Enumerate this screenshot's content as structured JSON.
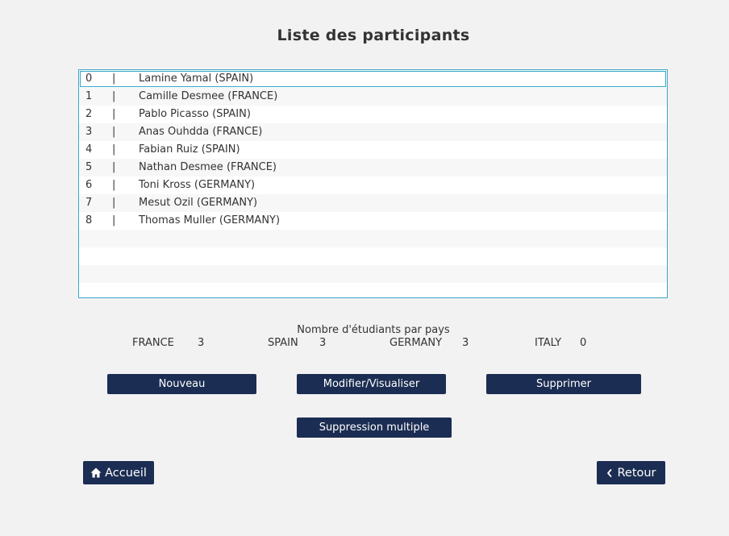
{
  "page": {
    "title": "Liste des participants"
  },
  "participants": {
    "separator": "|",
    "rows": [
      {
        "index": "0",
        "name": "Lamine Yamal (SPAIN)"
      },
      {
        "index": "1",
        "name": "Camille Desmee (FRANCE)"
      },
      {
        "index": "2",
        "name": "Pablo Picasso (SPAIN)"
      },
      {
        "index": "3",
        "name": "Anas Ouhdda (FRANCE)"
      },
      {
        "index": "4",
        "name": "Fabian Ruiz (SPAIN)"
      },
      {
        "index": "5",
        "name": "Nathan Desmee (FRANCE)"
      },
      {
        "index": "6",
        "name": "Toni Kross (GERMANY)"
      },
      {
        "index": "7",
        "name": "Mesut Ozil (GERMANY)"
      },
      {
        "index": "8",
        "name": "Thomas Muller (GERMANY)"
      }
    ],
    "selected_index": 0
  },
  "stats": {
    "title": "Nombre d'étudiants par pays",
    "countries": [
      {
        "name": "FRANCE",
        "count": "3"
      },
      {
        "name": "SPAIN",
        "count": "3"
      },
      {
        "name": "GERMANY",
        "count": "3"
      },
      {
        "name": "ITALY",
        "count": "0"
      }
    ]
  },
  "actions": {
    "new_label": "Nouveau",
    "edit_label": "Modifier/Visualiser",
    "delete_label": "Supprimer",
    "multi_delete_label": "Suppression multiple"
  },
  "navigation": {
    "home_label": "Accueil",
    "home_icon": "home-icon",
    "back_label": "Retour",
    "back_icon": "chevron-left-icon"
  },
  "colors": {
    "button_bg": "#1b2d52",
    "list_border": "#3aa6c9",
    "page_bg": "#f2f2f2"
  }
}
